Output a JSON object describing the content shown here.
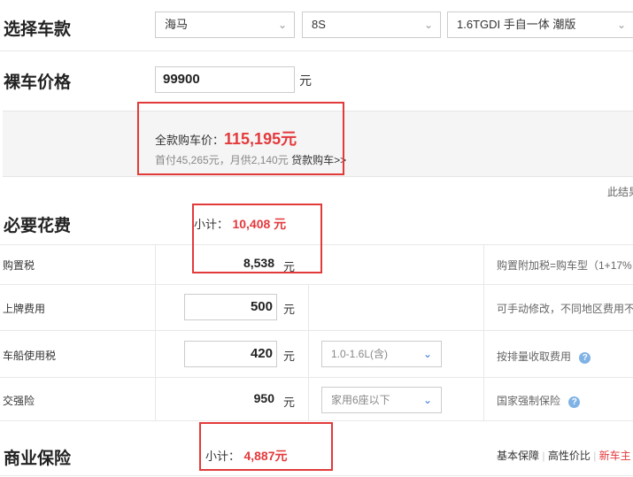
{
  "select_car": {
    "title": "选择车款",
    "brand": "海马",
    "series": "8S",
    "model": "1.6TGDI 手自一体 潮版"
  },
  "bare_price": {
    "title": "裸车价格",
    "value": "99900",
    "unit": "元"
  },
  "full_price": {
    "label": "全款购车价：",
    "value": "115,195元",
    "loan_info": "首付45,265元，月供2,140元",
    "loan_link": "贷款购车>>"
  },
  "truncated_right_note": "此结果",
  "required_costs": {
    "title": "必要花费",
    "subtotal_label": "小计：",
    "subtotal_value": "10,408 元",
    "rows": [
      {
        "label": "购置税",
        "value": "8,538",
        "unit": "元",
        "desc": "购置附加税=购车型（1+17%"
      },
      {
        "label": "上牌费用",
        "value": "500",
        "unit": "元",
        "desc": "可手动修改，不同地区费用不"
      },
      {
        "label": "车船使用税",
        "value": "420",
        "unit": "元",
        "option": "1.0-1.6L(含)",
        "desc": "按排量收取费用"
      },
      {
        "label": "交强险",
        "value": "950",
        "unit": "元",
        "option": "家用6座以下",
        "desc": "国家强制保险"
      }
    ]
  },
  "commercial_insurance": {
    "title": "商业保险",
    "subtotal_label": "小计：",
    "subtotal_value": "4,887元",
    "links": [
      "基本保障",
      "高性价比",
      "新车主"
    ]
  },
  "icons": {
    "chevron": "chevron-down-icon",
    "help": "question-circle-icon"
  },
  "colors": {
    "accent_red": "#e4393c",
    "highlight_box": "#e23a3a",
    "link_blue": "#3b7bd1"
  }
}
